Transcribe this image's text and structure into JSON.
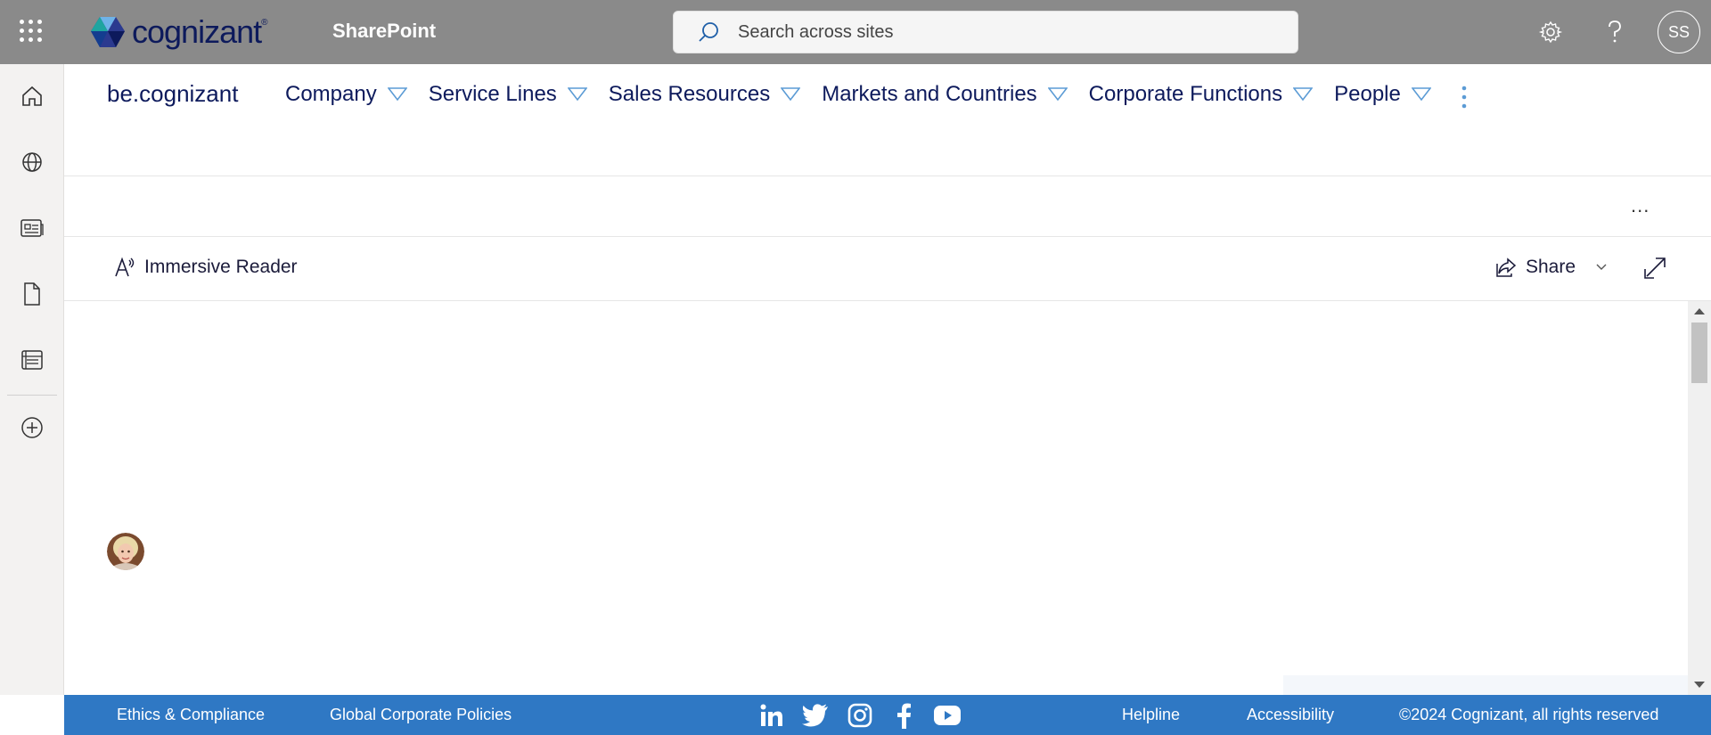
{
  "suitebar": {
    "brand": "cognizant",
    "app_name": "SharePoint",
    "search_placeholder": "Search across sites",
    "user_initials": "SS"
  },
  "hubnav": {
    "site_title": "be.cognizant",
    "links": [
      {
        "label": "Company"
      },
      {
        "label": "Service Lines"
      },
      {
        "label": "Sales Resources"
      },
      {
        "label": "Markets and Countries"
      },
      {
        "label": "Corporate Functions"
      },
      {
        "label": "People"
      }
    ]
  },
  "commandbar": {
    "more_label": "...",
    "immersive_reader": "Immersive Reader",
    "share": "Share"
  },
  "footer": {
    "ethics": "Ethics & Compliance",
    "policies": "Global Corporate Policies",
    "helpline": "Helpline",
    "accessibility": "Accessibility",
    "copyright": "©2024 Cognizant, all rights reserved"
  },
  "colors": {
    "suitebar_bg": "#8a8a8a",
    "brand_navy": "#0d1a5c",
    "footer_bg": "#2f78c4",
    "nav_triangle": "#5b9bd5"
  }
}
